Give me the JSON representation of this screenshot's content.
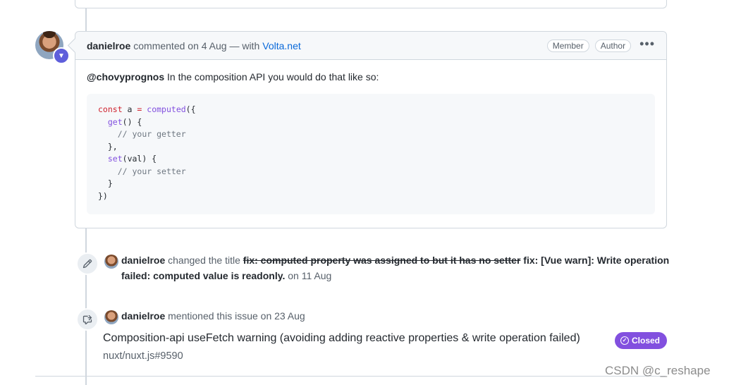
{
  "comment": {
    "author": "danielroe",
    "meta": "commented on 4 Aug — with",
    "via_link": "Volta.net",
    "badges": [
      "Member",
      "Author"
    ],
    "more_label": "•••",
    "mention": "@chovyprognos",
    "text": " In the composition API you would do that like so:",
    "code_lines": [
      [
        {
          "t": "const",
          "c": "kw"
        },
        {
          "t": " a "
        },
        {
          "t": "=",
          "c": "kw"
        },
        {
          "t": " "
        },
        {
          "t": "computed",
          "c": "fn"
        },
        {
          "t": "({"
        }
      ],
      [
        {
          "t": "  "
        },
        {
          "t": "get",
          "c": "fn"
        },
        {
          "t": "() {"
        }
      ],
      [
        {
          "t": "    "
        },
        {
          "t": "// your getter",
          "c": "cm"
        }
      ],
      [
        {
          "t": "  },"
        }
      ],
      [
        {
          "t": "  "
        },
        {
          "t": "set",
          "c": "fn"
        },
        {
          "t": "(val) {"
        }
      ],
      [
        {
          "t": "    "
        },
        {
          "t": "// your setter",
          "c": "cm"
        }
      ],
      [
        {
          "t": "  }"
        }
      ],
      [
        {
          "t": "})"
        }
      ]
    ]
  },
  "rename_event": {
    "author": "danielroe",
    "action": " changed the title ",
    "old_title": "fix: computed property was assigned to but it has no setter",
    "new_title": " fix: [Vue warn]: Write operation failed: computed value is readonly.",
    "date": " on 11 Aug"
  },
  "mention_event": {
    "author": "danielroe",
    "action": " mentioned this issue on 23 Aug",
    "ref_title": "Composition-api useFetch warning (avoiding adding reactive properties & write operation failed)",
    "ref_repo": "nuxt/nuxt.js#9590",
    "status": "Closed",
    "status_color": "#8250df"
  },
  "watermark": "CSDN @c_reshape",
  "icons": {
    "rename": "pencil-icon",
    "mention": "cross-reference-icon",
    "badge": "volta-badge-icon",
    "closed": "check-circle-icon"
  }
}
